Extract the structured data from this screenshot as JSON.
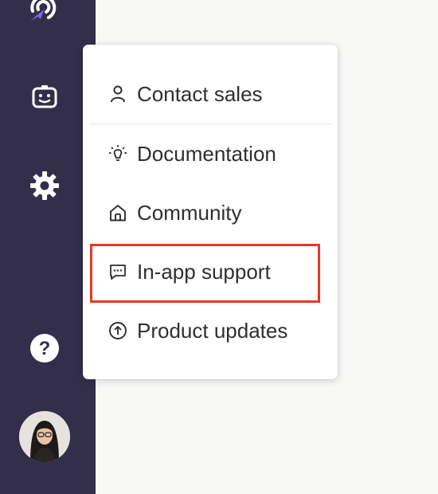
{
  "sidebar": {
    "icons": [
      {
        "name": "app-logo-icon"
      },
      {
        "name": "bot-icon"
      },
      {
        "name": "settings-gear-icon"
      },
      {
        "name": "help-icon",
        "glyph": "?"
      }
    ],
    "colors": {
      "background": "#332f4b",
      "accent": "#7c6cf0",
      "icon": "#ffffff"
    }
  },
  "menu": {
    "items": [
      {
        "label": "Contact sales",
        "icon": "person-icon"
      },
      {
        "label": "Documentation",
        "icon": "lightbulb-icon"
      },
      {
        "label": "Community",
        "icon": "home-icon"
      },
      {
        "label": "In-app support",
        "icon": "chat-bubble-icon",
        "highlighted": true
      },
      {
        "label": "Product updates",
        "icon": "arrow-up-circle-icon"
      }
    ],
    "highlight_color": "#e43a27"
  }
}
